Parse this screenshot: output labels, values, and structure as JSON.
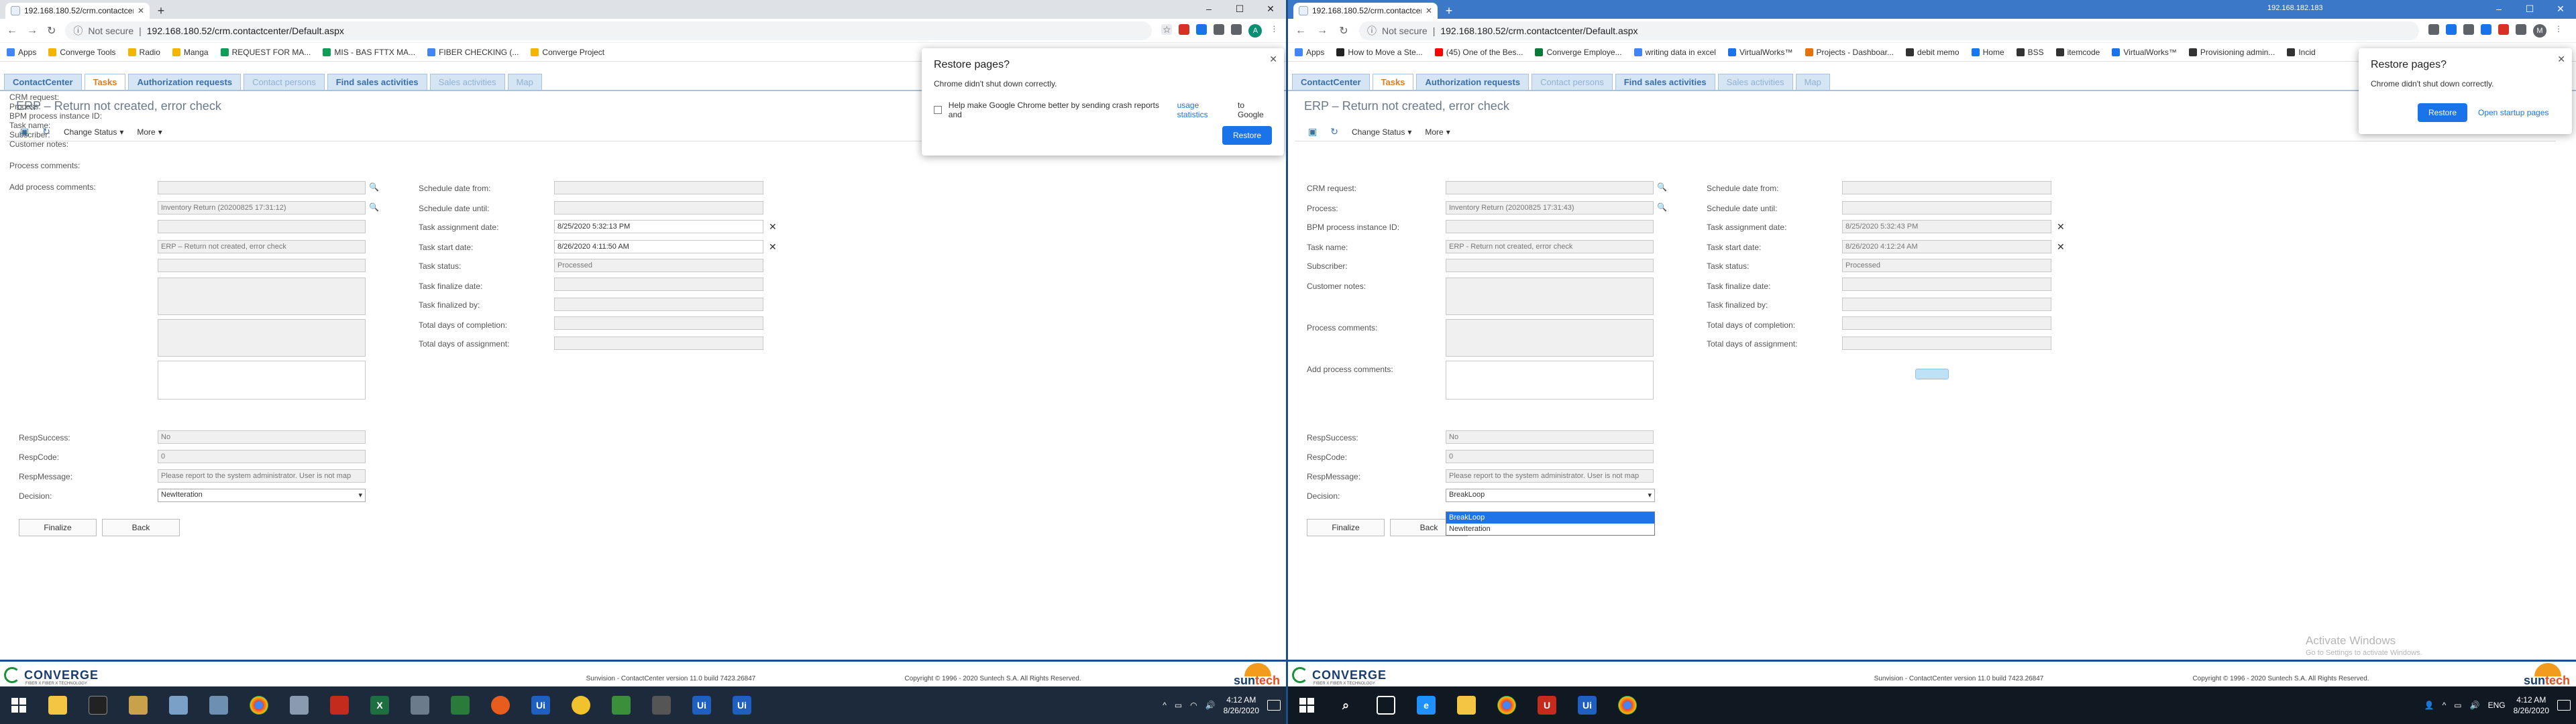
{
  "left": {
    "tab_title": "192.168.180.52/crm.contactcenter/",
    "url_security": "Not secure",
    "url": "192.168.180.52/crm.contactcenter/Default.aspx",
    "bookmarks": [
      "Apps",
      "Converge Tools",
      "Radio",
      "Manga",
      "REQUEST FOR MA...",
      "MIS - BAS FTTX MA...",
      "FIBER CHECKING (...",
      "Converge Project"
    ],
    "profile_initial": "A",
    "restore": {
      "title": "Restore pages?",
      "message": "Chrome didn't shut down correctly.",
      "checkbox_text": "Help make Google Chrome better by sending crash reports and",
      "checkbox_link": "usage statistics",
      "checkbox_suffix": "to Google",
      "button": "Restore"
    },
    "form": {
      "process": "Inventory Return (20200825 17:31:12)",
      "task_name": "ERP – Return not created, error check",
      "task_assignment_date": "8/25/2020 5:32:13 PM",
      "task_start_date": "8/26/2020 4:11:50 AM",
      "task_status": "Processed",
      "resp_success": "No",
      "resp_code": "0",
      "resp_message": "Please report to the system administrator. User is not map",
      "decision": "NewIteration"
    },
    "taskbar_clock_time": "4:12 AM",
    "taskbar_clock_date": "8/26/2020"
  },
  "right": {
    "tab_title": "192.168.180.52/crm.contactcente",
    "window_title": "192.168.182.183",
    "url_security": "Not secure",
    "url": "192.168.180.52/crm.contactcenter/Default.aspx",
    "bookmarks": [
      "Apps",
      "How to Move a Ste...",
      "(45) One of the Bes...",
      "Converge Employe...",
      "writing data in excel",
      "VirtualWorks™",
      "Projects - Dashboar...",
      "debit memo",
      "Home",
      "BSS",
      "itemcode",
      "VirtualWorks™",
      "Provisioning admin...",
      "Incid"
    ],
    "profile_initial": "M",
    "restore": {
      "title": "Restore pages?",
      "message": "Chrome didn't shut down correctly.",
      "button": "Restore",
      "link": "Open startup pages"
    },
    "form": {
      "process": "Inventory Return (20200825 17:31:43)",
      "task_name": "ERP - Return not created, error check",
      "task_assignment_date": "8/25/2020 5:32:43 PM",
      "task_start_date": "8/26/2020 4:12:24 AM",
      "task_status": "Processed",
      "resp_success": "No",
      "resp_code": "0",
      "resp_message": "Please report to the system administrator. User is not map",
      "decision": "BreakLoop"
    },
    "decision_options": [
      "BreakLoop",
      "NewIteration"
    ],
    "watermark_title": "Activate Windows",
    "watermark_sub": "Go to Settings to activate Windows.",
    "taskbar_clock_time": "4:12 AM",
    "taskbar_clock_date": "8/26/2020"
  },
  "app": {
    "tabs": [
      "ContactCenter",
      "Tasks",
      "Authorization requests",
      "Contact persons",
      "Find sales activities",
      "Sales activities",
      "Map"
    ],
    "page_title": "ERP – Return not created, error check",
    "change_status": "Change Status",
    "more": "More",
    "labels": {
      "crm_request": "CRM request:",
      "process": "Process:",
      "bpm_id": "BPM process instance ID:",
      "task_name": "Task name:",
      "subscriber": "Subscriber:",
      "customer_notes": "Customer notes:",
      "process_comments": "Process comments:",
      "add_process_comments": "Add process comments:",
      "schedule_from": "Schedule date from:",
      "schedule_until": "Schedule date until:",
      "task_assignment_date": "Task assignment date:",
      "task_start_date": "Task start date:",
      "task_status": "Task status:",
      "task_finalize_date": "Task finalize date:",
      "task_finalized_by": "Task finalized by:",
      "total_days_completion": "Total days of completion:",
      "total_days_assignment": "Total days of assignment:",
      "resp_success": "RespSuccess:",
      "resp_code": "RespCode:",
      "resp_message": "RespMessage:",
      "decision": "Decision:"
    },
    "finalize": "Finalize",
    "back": "Back",
    "footer_version": "Sunvision - ContactCenter version 11.0 build 7423.26847",
    "footer_copyright": "Copyright © 1996 - 2020 Suntech S.A. All Rights Reserved.",
    "logo_left": "CONVERGE",
    "logo_left_tag": "FIBER X FIBER X TECHNOLOGY",
    "logo_right_a": "sun",
    "logo_right_b": "tech"
  },
  "colors": {
    "accent_blue": "#3a6fa8",
    "active_tab": "#e07b1f",
    "chrome_blue": "#1a73e8",
    "footer_rule": "#1a4f8b"
  }
}
